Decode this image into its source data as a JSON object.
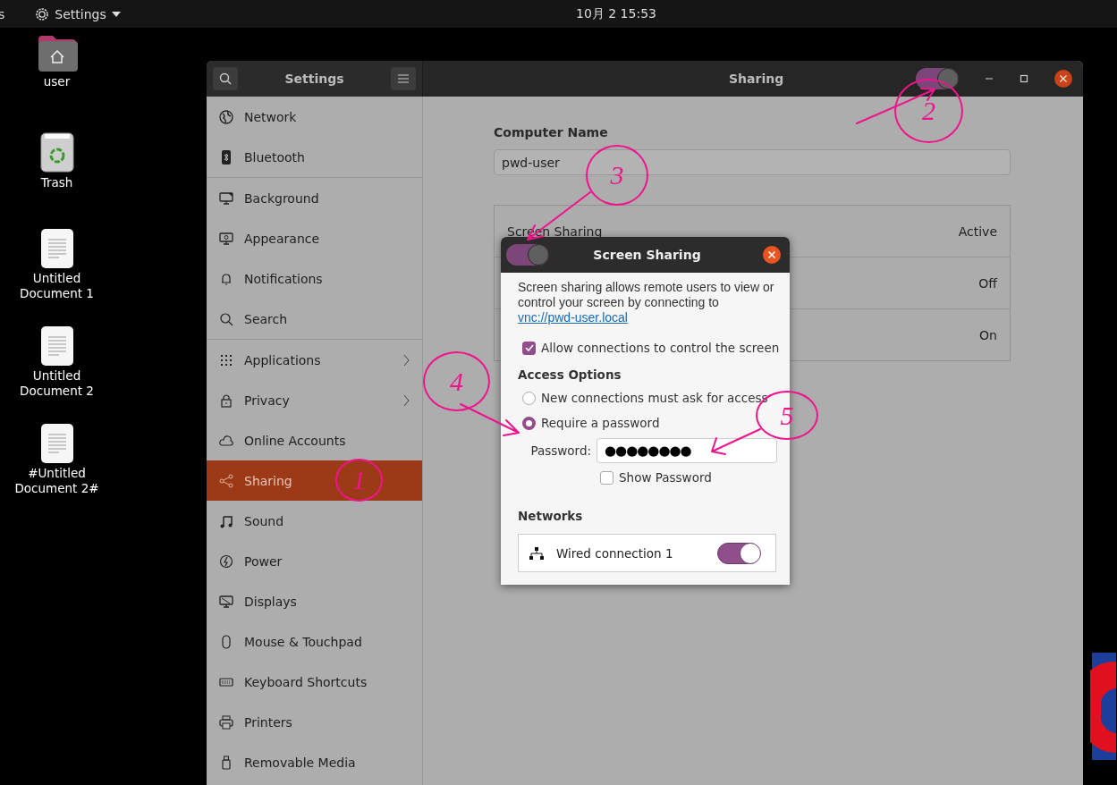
{
  "top_bar": {
    "activities": "s",
    "app_menu": "Settings",
    "clock": "10月 2  15:53"
  },
  "desktop_icons": [
    {
      "kind": "home",
      "label": "user"
    },
    {
      "kind": "trash",
      "label": "Trash"
    },
    {
      "kind": "document",
      "label": "Untitled Document 1"
    },
    {
      "kind": "document",
      "label": "Untitled Document 2"
    },
    {
      "kind": "document",
      "label": "#Untitled Document 2#"
    }
  ],
  "settings_window": {
    "sidebar_title": "Settings",
    "title": "Sharing",
    "sharing_on": true
  },
  "sidebar": {
    "groups": [
      {
        "items": [
          {
            "label": "Network",
            "selected": false,
            "submenu": false
          },
          {
            "label": "Bluetooth",
            "selected": false,
            "submenu": false
          }
        ]
      },
      {
        "items": [
          {
            "label": "Background",
            "selected": false,
            "submenu": false
          },
          {
            "label": "Appearance",
            "selected": false,
            "submenu": false
          },
          {
            "label": "Notifications",
            "selected": false,
            "submenu": false
          },
          {
            "label": "Search",
            "selected": false,
            "submenu": false
          }
        ]
      },
      {
        "items": [
          {
            "label": "Applications",
            "selected": false,
            "submenu": true
          },
          {
            "label": "Privacy",
            "selected": false,
            "submenu": true
          },
          {
            "label": "Online Accounts",
            "selected": false,
            "submenu": false
          },
          {
            "label": "Sharing",
            "selected": true,
            "submenu": false
          },
          {
            "label": "Sound",
            "selected": false,
            "submenu": false
          },
          {
            "label": "Power",
            "selected": false,
            "submenu": false
          },
          {
            "label": "Displays",
            "selected": false,
            "submenu": false
          },
          {
            "label": "Mouse & Touchpad",
            "selected": false,
            "submenu": false
          },
          {
            "label": "Keyboard Shortcuts",
            "selected": false,
            "submenu": false
          },
          {
            "label": "Printers",
            "selected": false,
            "submenu": false
          },
          {
            "label": "Removable Media",
            "selected": false,
            "submenu": false
          }
        ]
      }
    ]
  },
  "sharing": {
    "computer_name_label": "Computer Name",
    "computer_name": "pwd-user",
    "services": [
      {
        "label": "Screen Sharing",
        "status": "Active"
      },
      {
        "status": "Off"
      },
      {
        "status": "On"
      }
    ]
  },
  "dialog": {
    "title": "Screen Sharing",
    "enabled": true,
    "description": "Screen sharing allows remote users to view or control your screen by connecting to",
    "link": "vnc://pwd-user.local",
    "allow_control": {
      "label": "Allow connections to control the screen",
      "checked": true
    },
    "access_options_heading": "Access Options",
    "access_options": [
      {
        "label": "New connections must ask for access",
        "selected": false
      },
      {
        "label": "Require a password",
        "selected": true
      }
    ],
    "password_label": "Password:",
    "password": "●●●●●●●●",
    "show_password": {
      "label": "Show Password",
      "checked": false
    },
    "networks_heading": "Networks",
    "networks": [
      {
        "label": "Wired connection 1",
        "on": true
      }
    ]
  },
  "annotations": [
    {
      "label": "1"
    },
    {
      "label": "2"
    },
    {
      "label": "3"
    },
    {
      "label": "4"
    },
    {
      "label": "5"
    }
  ]
}
